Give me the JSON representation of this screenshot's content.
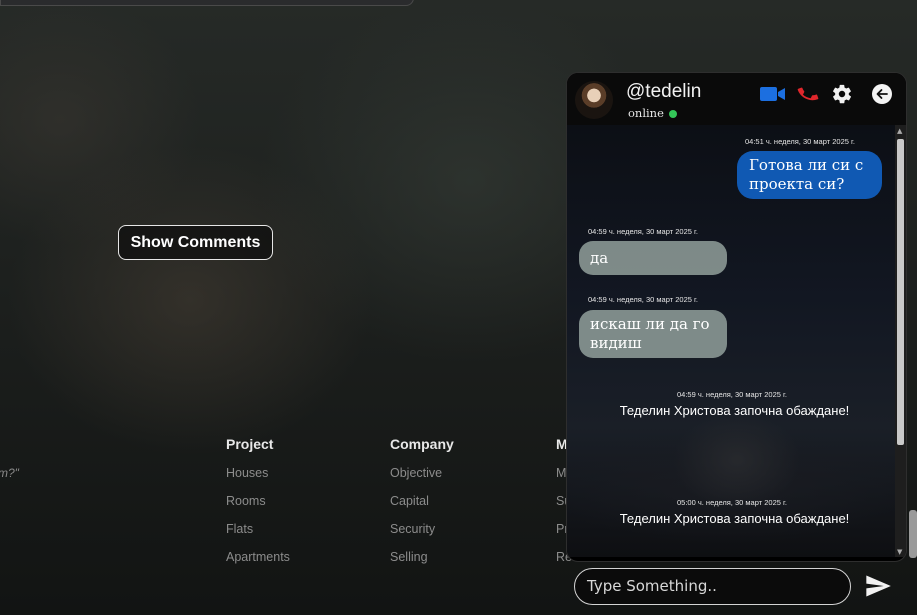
{
  "page": {
    "show_comments": "Show Comments",
    "quote_fragment": "m?\""
  },
  "footer": {
    "columns": [
      {
        "heading": "Project",
        "links": [
          "Houses",
          "Rooms",
          "Flats",
          "Apartments"
        ]
      },
      {
        "heading": "Company",
        "links": [
          "Objective",
          "Capital",
          "Security",
          "Selling"
        ]
      },
      {
        "heading": "M",
        "links": [
          "Me",
          "Su",
          "Pr",
          "Re"
        ]
      }
    ]
  },
  "chat": {
    "username": "@tedelin",
    "status": "online",
    "colors": {
      "accent": "#1059b3",
      "online": "#34c759",
      "call": "#e0262b",
      "video": "#1c6fe0"
    },
    "icons": [
      "video-icon",
      "phone-icon",
      "gear-icon",
      "back-arrow-icon",
      "send-icon"
    ],
    "messages": [
      {
        "type": "outgoing",
        "time": "04:51 ч. неделя, 30 март 2025 г.",
        "text": "Готова ли си с проекта си?"
      },
      {
        "type": "incoming",
        "time": "04:59 ч. неделя, 30 март 2025 г.",
        "text": "да"
      },
      {
        "type": "incoming",
        "time": "04:59 ч. неделя, 30 март 2025 г.",
        "text": "искаш ли да го видиш"
      },
      {
        "type": "system",
        "time": "04:59 ч. неделя, 30 март 2025 г.",
        "text": "Теделин Христова започна обаждане!"
      },
      {
        "type": "system",
        "time": "05:00 ч. неделя, 30 март 2025 г.",
        "text": "Теделин Христова започна обаждане!"
      }
    ],
    "input_placeholder": "Type Something.."
  }
}
